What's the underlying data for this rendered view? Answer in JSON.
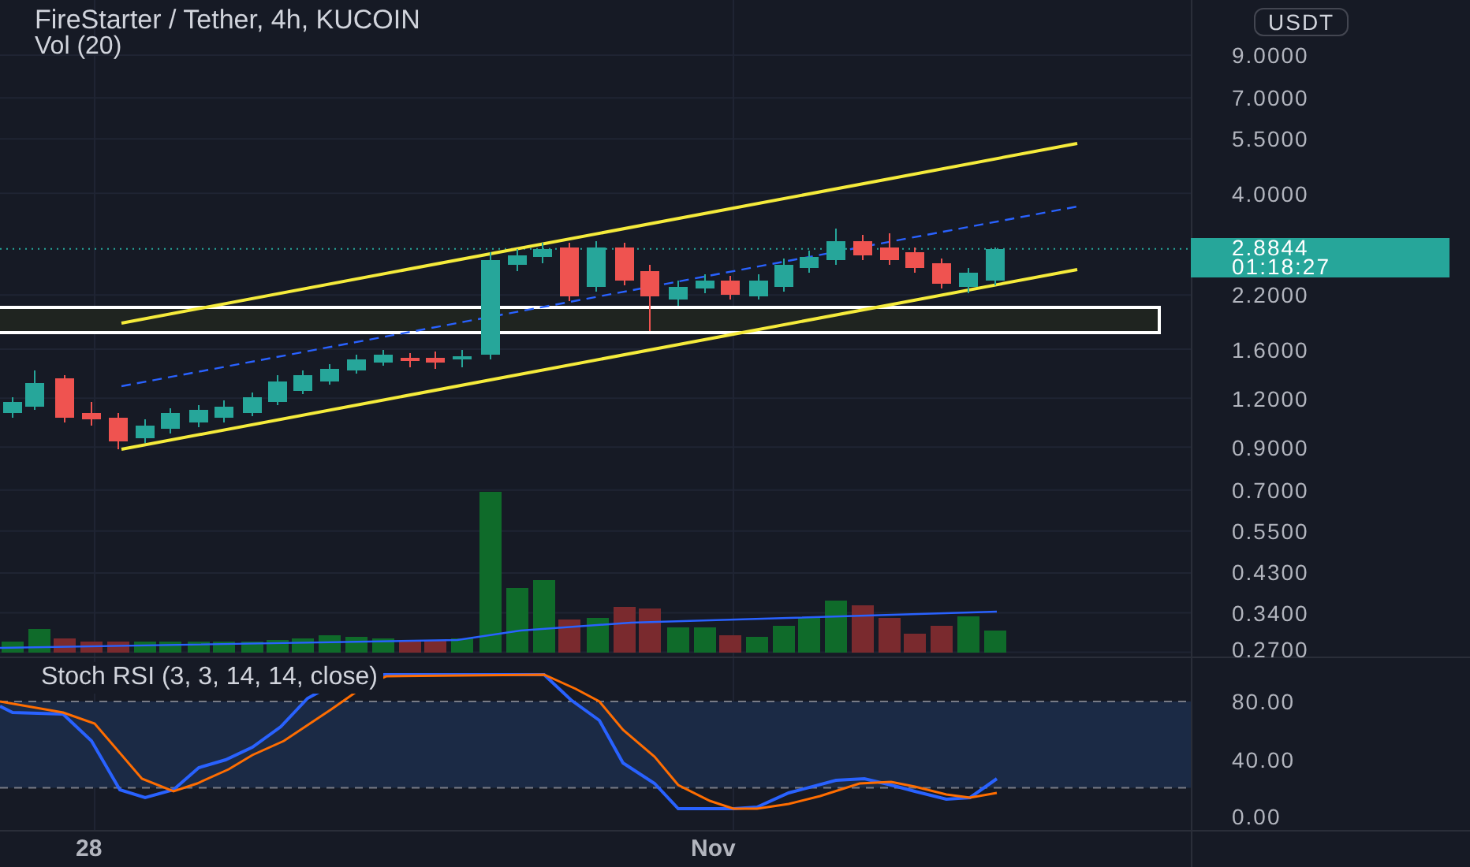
{
  "title": "FireStarter / Tether, 4h, KUCOIN",
  "volume_label": "Vol (20)",
  "price_axis": {
    "currency": "USDT",
    "ticks": [
      "9.0000",
      "7.0000",
      "5.5000",
      "4.0000",
      "2.2000",
      "1.6000",
      "1.2000",
      "0.9000",
      "0.7000",
      "0.5500",
      "0.4300",
      "0.3400",
      "0.2700"
    ],
    "last_price": {
      "price": "2.8844",
      "countdown": "01:18:27"
    }
  },
  "stoch_rsi": {
    "label": "Stoch RSI (3, 3, 14, 14, close)",
    "ticks": [
      "80.00",
      "40.00",
      "0.00"
    ]
  },
  "time_axis": [
    "28",
    "Nov"
  ]
}
